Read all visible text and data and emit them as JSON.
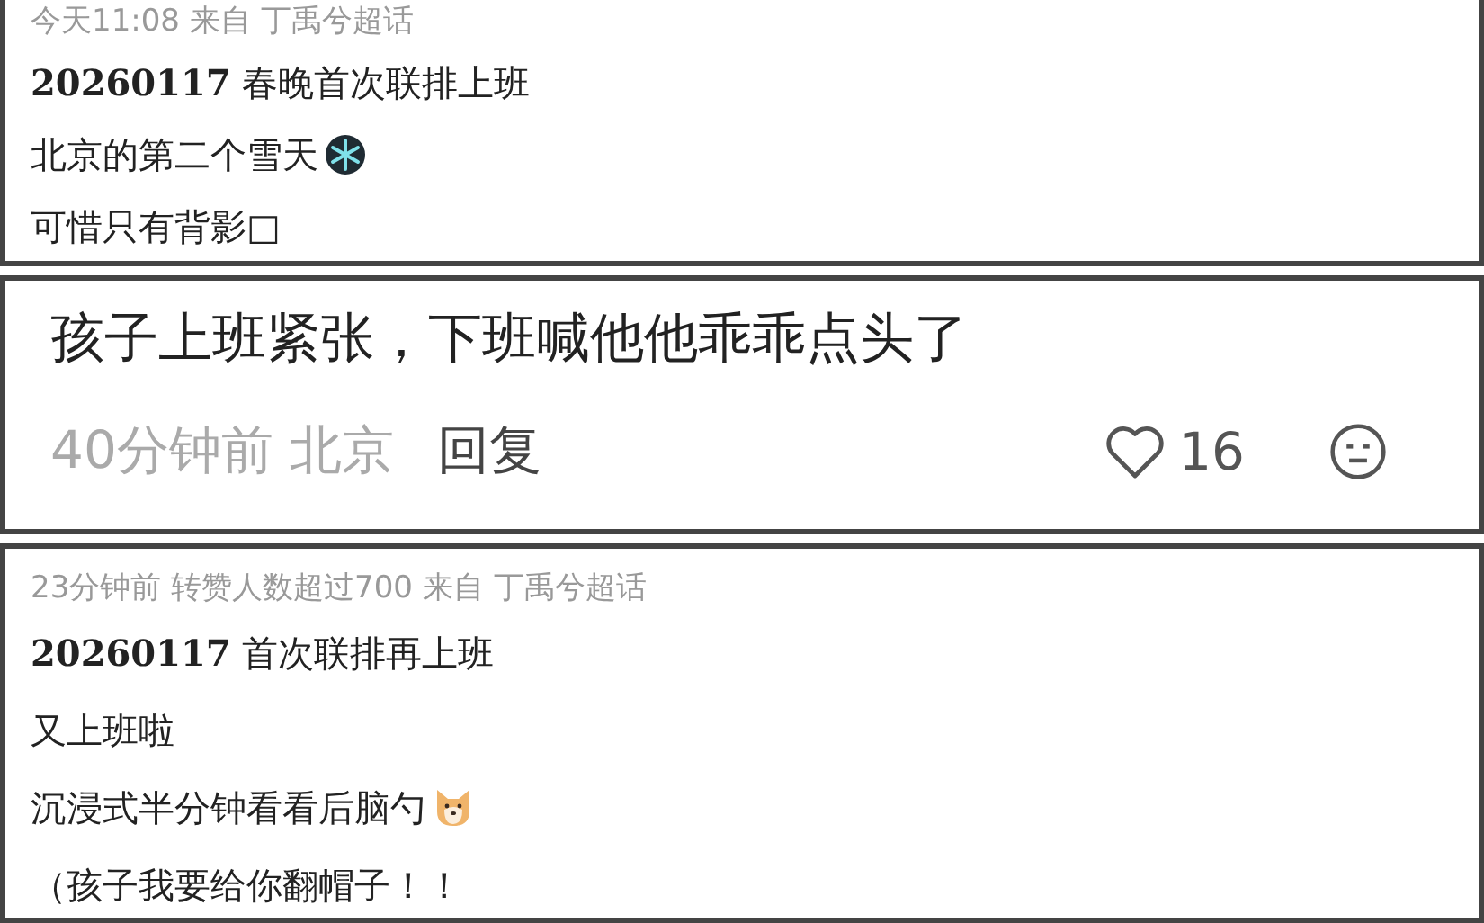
{
  "posts": [
    {
      "meta": "今天11:08  来自 丁禹兮超话",
      "lines": [
        {
          "text": "**20260117** 春晚首次联排上班",
          "kind": "plain"
        },
        {
          "text": "北京的第二个雪天",
          "kind": "snowflake"
        },
        {
          "text": "可惜只有背影□",
          "kind": "plain"
        }
      ]
    },
    {
      "comment": "孩子上班紧张，下班喊他他乖乖点头了",
      "time": "40分钟前 北京",
      "reply": "回复",
      "likes": "16"
    },
    {
      "meta": "23分钟前 转赞人数超过700  来自 丁禹兮超话",
      "lines": [
        {
          "text": "**20260117** 首次联排再上班",
          "kind": "plain"
        },
        {
          "text": "又上班啦",
          "kind": "plain"
        },
        {
          "text": "沉浸式半分钟看看后脑勺",
          "kind": "dog"
        },
        {
          "text": "（孩子我要给你翻帽子！！",
          "kind": "plain"
        }
      ]
    }
  ]
}
